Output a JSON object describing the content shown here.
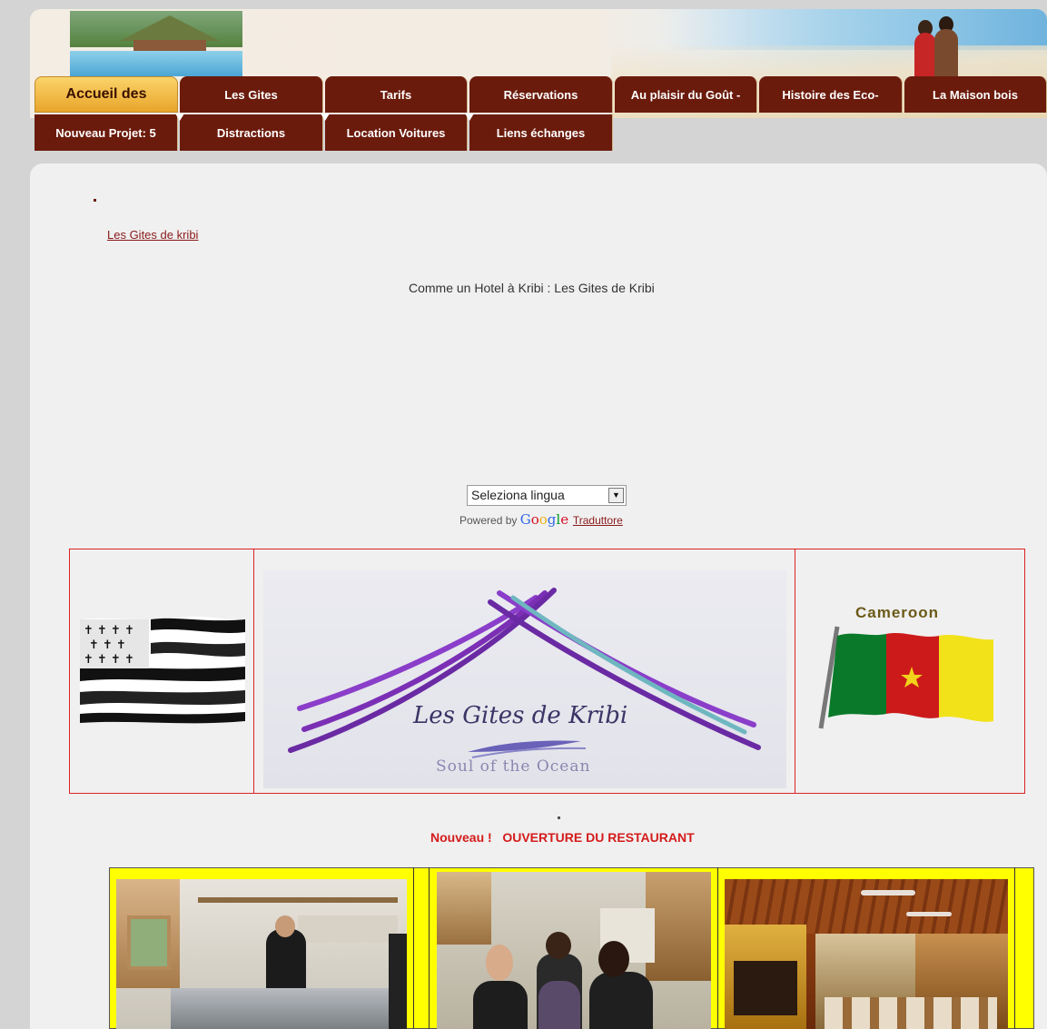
{
  "nav": {
    "row1": [
      {
        "label": "Accueil des",
        "active": true
      },
      {
        "label": "Les Gites"
      },
      {
        "label": "Tarifs"
      },
      {
        "label": "Réservations"
      },
      {
        "label": "Au plaisir du Goût -"
      },
      {
        "label": "Histoire des Eco-"
      },
      {
        "label": "La Maison bois"
      }
    ],
    "row2": [
      {
        "label": "Nouveau Projet: 5"
      },
      {
        "label": "Distractions"
      },
      {
        "label": "Location Voitures"
      },
      {
        "label": "Liens échanges"
      }
    ]
  },
  "content": {
    "top_link": "Les Gites de kribi",
    "subtitle": "Comme un Hotel à Kribi : Les Gites de Kribi",
    "translate": {
      "select_value": "Seleziona lingua",
      "powered_prefix": "Powered by",
      "brand": "Google",
      "link": "Traduttore"
    },
    "banner": {
      "logo_title": "Les Gites de Kribi",
      "logo_subtitle": "Soul of the Ocean",
      "right_flag_label": "Cameroon"
    },
    "announcement": "Nouveau !   OUVERTURE DU RESTAURANT"
  },
  "colors": {
    "tab_bg": "#6b1b0c",
    "active_tab": "#f4be4a",
    "announcement": "#d41b1b",
    "photo_frame": "#ffff00"
  }
}
